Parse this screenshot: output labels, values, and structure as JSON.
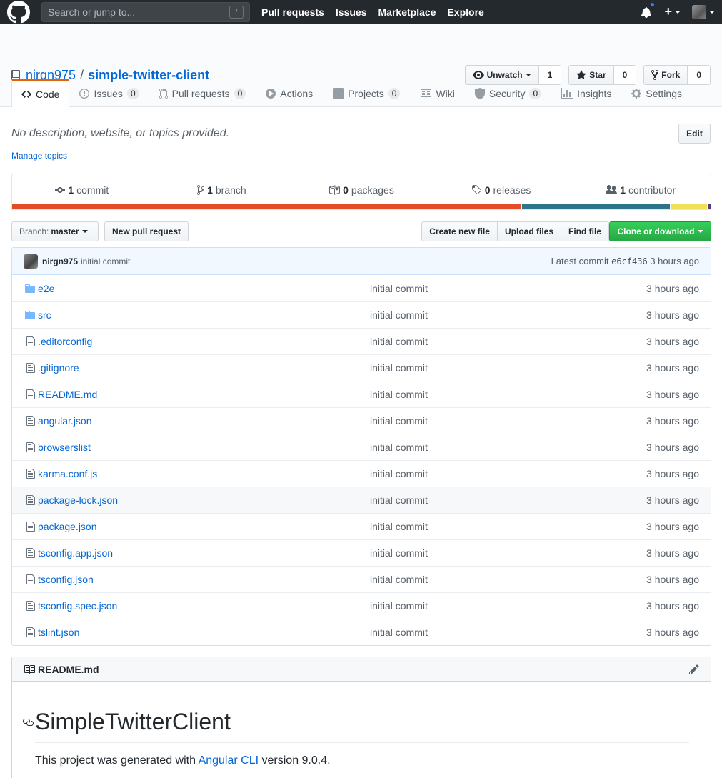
{
  "topbar": {
    "search_placeholder": "Search or jump to...",
    "slash_key": "/",
    "nav": [
      "Pull requests",
      "Issues",
      "Marketplace",
      "Explore"
    ]
  },
  "repo": {
    "owner": "nirgn975",
    "separator": "/",
    "name": "simple-twitter-client"
  },
  "actions": {
    "watch_label": "Unwatch",
    "watch_count": "1",
    "star_label": "Star",
    "star_count": "0",
    "fork_label": "Fork",
    "fork_count": "0"
  },
  "tabs": [
    {
      "label": "Code",
      "count": null
    },
    {
      "label": "Issues",
      "count": "0"
    },
    {
      "label": "Pull requests",
      "count": "0"
    },
    {
      "label": "Actions",
      "count": null
    },
    {
      "label": "Projects",
      "count": "0"
    },
    {
      "label": "Wiki",
      "count": null
    },
    {
      "label": "Security",
      "count": "0"
    },
    {
      "label": "Insights",
      "count": null
    },
    {
      "label": "Settings",
      "count": null
    }
  ],
  "description": "No description, website, or topics provided.",
  "manage_topics": "Manage topics",
  "edit_label": "Edit",
  "summary": [
    {
      "num": "1",
      "label": "commit"
    },
    {
      "num": "1",
      "label": "branch"
    },
    {
      "num": "0",
      "label": "packages"
    },
    {
      "num": "0",
      "label": "releases"
    },
    {
      "num": "1",
      "label": "contributor"
    }
  ],
  "languages": [
    {
      "color": "#e34c26",
      "share": 0.732
    },
    {
      "color": "#2b7489",
      "share": 0.213
    },
    {
      "color": "#f1e05a",
      "share": 0.052
    },
    {
      "color": "#563d7c",
      "share": 0.003
    }
  ],
  "filebar": {
    "branch_prefix": "Branch:",
    "branch": "master",
    "new_pr": "New pull request",
    "create_file": "Create new file",
    "upload": "Upload files",
    "find": "Find file",
    "clone": "Clone or download"
  },
  "commit": {
    "author": "nirgn975",
    "message": "initial commit",
    "latest_label": "Latest commit",
    "sha": "e6cf436",
    "age": "3 hours ago"
  },
  "files": [
    {
      "name": "e2e",
      "type": "dir",
      "message": "initial commit",
      "age": "3 hours ago"
    },
    {
      "name": "src",
      "type": "dir",
      "message": "initial commit",
      "age": "3 hours ago"
    },
    {
      "name": ".editorconfig",
      "type": "file",
      "message": "initial commit",
      "age": "3 hours ago"
    },
    {
      "name": ".gitignore",
      "type": "file",
      "message": "initial commit",
      "age": "3 hours ago"
    },
    {
      "name": "README.md",
      "type": "file",
      "message": "initial commit",
      "age": "3 hours ago"
    },
    {
      "name": "angular.json",
      "type": "file",
      "message": "initial commit",
      "age": "3 hours ago"
    },
    {
      "name": "browserslist",
      "type": "file",
      "message": "initial commit",
      "age": "3 hours ago"
    },
    {
      "name": "karma.conf.js",
      "type": "file",
      "message": "initial commit",
      "age": "3 hours ago"
    },
    {
      "name": "package-lock.json",
      "type": "file",
      "message": "initial commit",
      "age": "3 hours ago"
    },
    {
      "name": "package.json",
      "type": "file",
      "message": "initial commit",
      "age": "3 hours ago"
    },
    {
      "name": "tsconfig.app.json",
      "type": "file",
      "message": "initial commit",
      "age": "3 hours ago"
    },
    {
      "name": "tsconfig.json",
      "type": "file",
      "message": "initial commit",
      "age": "3 hours ago"
    },
    {
      "name": "tsconfig.spec.json",
      "type": "file",
      "message": "initial commit",
      "age": "3 hours ago"
    },
    {
      "name": "tslint.json",
      "type": "file",
      "message": "initial commit",
      "age": "3 hours ago"
    }
  ],
  "readme": {
    "filename": "README.md",
    "heading": "SimpleTwitterClient",
    "text_before": "This project was generated with ",
    "link": "Angular CLI",
    "text_after": " version 9.0.4."
  }
}
